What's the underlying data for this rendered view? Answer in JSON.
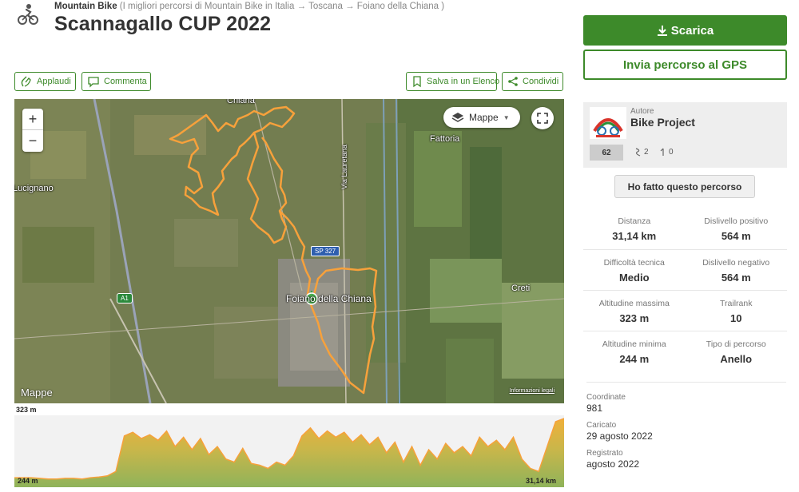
{
  "header": {
    "category": "Mountain Bike",
    "breadcrumb_trail": "(I migliori percorsi di Mountain Bike in Italia → Toscana → Foiano della Chiana )",
    "title": "Scannagallo CUP 2022"
  },
  "actions": {
    "applaudi": "Applaudi",
    "commenta": "Commenta",
    "salva": "Salva in un Elenco",
    "condividi": "Condividi"
  },
  "map": {
    "layer_selector": "Mappe",
    "brand": "Mappe",
    "legal": "Informazioni legali",
    "labels": {
      "chiana": "Chiana",
      "lucignano": "Lucignano",
      "fattoria": "Fattoria",
      "creti": "Creti",
      "street": "Via Lauretana",
      "town": "Foiano della Chiana"
    },
    "road_sp327": "SP 327",
    "road_a1": "A1"
  },
  "elevation": {
    "max_label": "323 m",
    "min_label": "244 m",
    "distance_label": "31,14 km",
    "profile": [
      0.05,
      0.05,
      0.05,
      0.04,
      0.03,
      0.03,
      0.04,
      0.04,
      0.03,
      0.05,
      0.06,
      0.08,
      0.15,
      0.72,
      0.78,
      0.68,
      0.74,
      0.65,
      0.8,
      0.55,
      0.7,
      0.5,
      0.68,
      0.42,
      0.55,
      0.35,
      0.3,
      0.52,
      0.28,
      0.25,
      0.2,
      0.3,
      0.25,
      0.4,
      0.72,
      0.85,
      0.68,
      0.8,
      0.7,
      0.78,
      0.62,
      0.74,
      0.58,
      0.7,
      0.45,
      0.62,
      0.3,
      0.55,
      0.25,
      0.5,
      0.35,
      0.6,
      0.45,
      0.55,
      0.4,
      0.7,
      0.55,
      0.65,
      0.5,
      0.7,
      0.35,
      0.2,
      0.15,
      0.55,
      0.95,
      1.0
    ]
  },
  "sidebar": {
    "download": "Scarica",
    "send_gps": "Invia percorso al GPS",
    "author_caption": "Autore",
    "author_name": "Bike Project",
    "author_badge": "62",
    "author_routes": "2",
    "author_followers": "0",
    "done_button": "Ho fatto questo percorso"
  },
  "stats": [
    {
      "label": "Distanza",
      "value": "31,14 km"
    },
    {
      "label": "Dislivello positivo",
      "value": "564 m"
    },
    {
      "label": "Difficoltà tecnica",
      "value": "Medio"
    },
    {
      "label": "Dislivello negativo",
      "value": "564 m"
    },
    {
      "label": "Altitudine massima",
      "value": "323 m"
    },
    {
      "label": "Trailrank",
      "value": "10"
    },
    {
      "label": "Altitudine minima",
      "value": "244 m"
    },
    {
      "label": "Tipo di percorso",
      "value": "Anello"
    }
  ],
  "meta": {
    "coords_label": "Coordinate",
    "coords_value": "981",
    "uploaded_label": "Caricato",
    "uploaded_value": "29 agosto 2022",
    "recorded_label": "Registrato",
    "recorded_value": "agosto 2022"
  },
  "colors": {
    "brand_green": "#3d8a2a",
    "track_orange": "#f7a13b",
    "elevation_fill": "#8fb35a"
  }
}
